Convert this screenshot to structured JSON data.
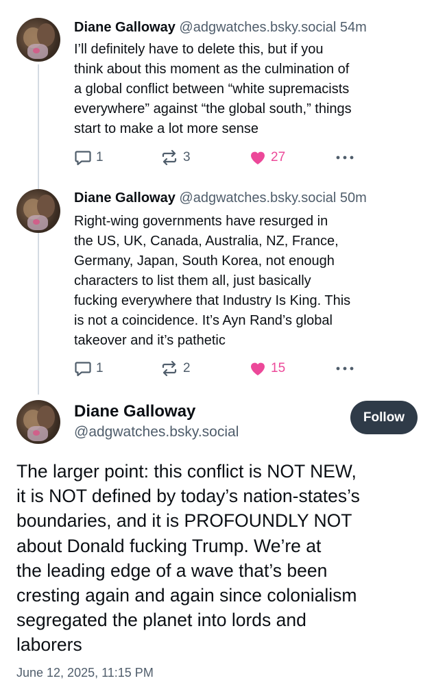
{
  "thread": [
    {
      "author": "Diane Galloway",
      "handle": "@adgwatches.bsky.social",
      "time": "54m",
      "text_lines": [
        "I’ll definitely have to delete this, but if you",
        "think about this moment as the culmination of",
        "a global conflict between “white supremacists",
        "everywhere” against “the global south,” things",
        "start to make a lot more sense"
      ],
      "replies": "1",
      "reposts": "3",
      "likes": "27"
    },
    {
      "author": "Diane Galloway",
      "handle": "@adgwatches.bsky.social",
      "time": "50m",
      "text_lines": [
        "Right-wing governments have resurged in",
        "the US, UK, Canada, Australia, NZ, France,",
        "Germany, Japan, South Korea, not enough",
        "characters to list them all, just basically",
        "fucking everywhere that Industry Is King. This",
        "is not a coincidence. It’s Ayn Rand’s global",
        "takeover and it’s pathetic"
      ],
      "replies": "1",
      "reposts": "2",
      "likes": "15"
    }
  ],
  "main_post": {
    "author": "Diane Galloway",
    "handle": "@adgwatches.bsky.social",
    "follow_label": "Follow",
    "text_lines": [
      "The larger point: this conflict is NOT NEW,",
      "it is NOT defined by today’s nation-states’s",
      "boundaries, and it is PROFOUNDLY NOT",
      "about Donald fucking Trump. We’re at",
      "the leading edge of a wave that’s been",
      "cresting again and again since colonialism",
      "segregated the planet into lords and",
      "laborers"
    ],
    "timestamp": "June 12, 2025, 11:15 PM"
  },
  "colors": {
    "like": "#ec4899",
    "muted": "#4f5d6b",
    "follow_bg": "#2f3b48",
    "thread_line": "#d4dbe2"
  },
  "icons": {
    "reply": "reply-bubble-icon",
    "repost": "repost-arrows-icon",
    "like": "heart-filled-icon",
    "more": "more-dots-icon"
  }
}
